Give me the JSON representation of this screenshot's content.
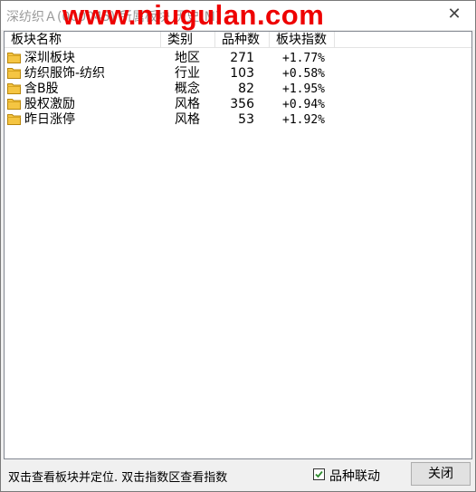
{
  "window": {
    "title": "深纺织Ａ(000045) 所属板块 历史(M)",
    "watermark": "www.niugulan.com",
    "close_glyph": "✕"
  },
  "table": {
    "headers": [
      "板块名称",
      "类别",
      "品种数",
      "板块指数"
    ],
    "rows": [
      {
        "name": "深圳板块",
        "type": "地区",
        "count": "271",
        "index": "+1.77%"
      },
      {
        "name": "纺织服饰-纺织",
        "type": "行业",
        "count": "103",
        "index": "+0.58%"
      },
      {
        "name": "含B股",
        "type": "概念",
        "count": "82",
        "index": "+1.95%"
      },
      {
        "name": "股权激励",
        "type": "风格",
        "count": "356",
        "index": "+0.94%"
      },
      {
        "name": "昨日涨停",
        "type": "风格",
        "count": "53",
        "index": "+1.92%"
      }
    ]
  },
  "footer": {
    "status": "双击查看板块并定位. 双击指数区查看指数",
    "checkbox_label": "品种联动",
    "checkbox_checked": true,
    "close_button": "关闭"
  },
  "colors": {
    "watermark": "#ee0000",
    "checkmark": "#2e8b2e",
    "folder": "#f5c542"
  },
  "icons": {
    "row_icon": "folder-icon",
    "close_icon": "close-icon",
    "check_icon": "checkmark-icon"
  }
}
